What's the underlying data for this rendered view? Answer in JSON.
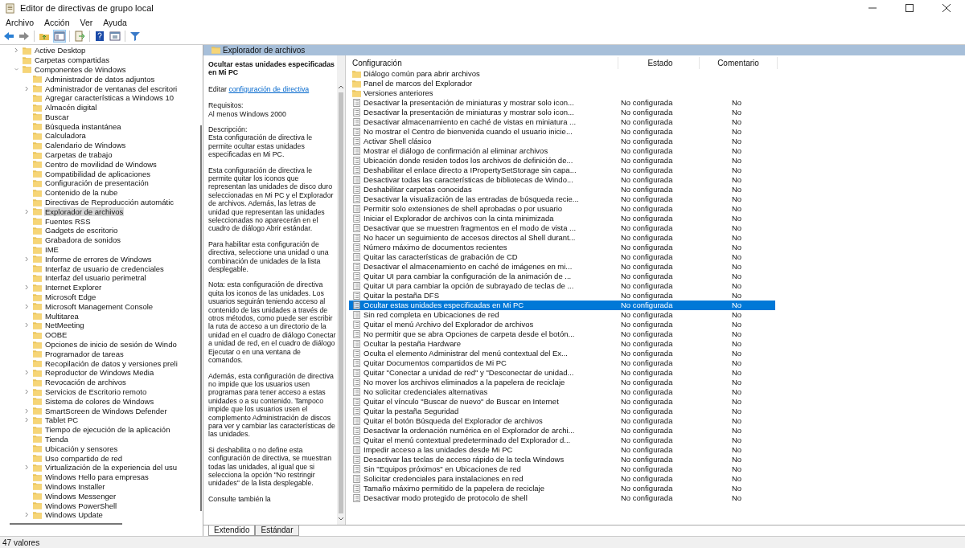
{
  "window": {
    "title": "Editor de directivas de grupo local"
  },
  "menu": [
    "Archivo",
    "Acción",
    "Ver",
    "Ayuda"
  ],
  "tree": [
    {
      "label": "Active Desktop",
      "expanded": false,
      "selected": false
    },
    {
      "label": "Carpetas compartidas",
      "selected": false
    },
    {
      "label": "Componentes de Windows",
      "expanded": true,
      "selected": false,
      "children": [
        {
          "label": "Administrador de datos adjuntos",
          "selected": false
        },
        {
          "label": "Administrador de ventanas del escritori",
          "expanded": false,
          "selected": false
        },
        {
          "label": "Agregar características a Windows 10",
          "selected": false
        },
        {
          "label": "Almacén digital",
          "selected": false
        },
        {
          "label": "Buscar",
          "selected": false
        },
        {
          "label": "Búsqueda instantánea",
          "selected": false
        },
        {
          "label": "Calculadora",
          "selected": false
        },
        {
          "label": "Calendario de Windows",
          "selected": false
        },
        {
          "label": "Carpetas de trabajo",
          "selected": false
        },
        {
          "label": "Centro de movilidad de Windows",
          "selected": false
        },
        {
          "label": "Compatibilidad de aplicaciones",
          "selected": false
        },
        {
          "label": "Configuración de presentación",
          "selected": false
        },
        {
          "label": "Contenido de la nube",
          "selected": false
        },
        {
          "label": "Directivas de Reproducción automátic",
          "selected": false
        },
        {
          "label": "Explorador de archivos",
          "expanded": false,
          "selected": true
        },
        {
          "label": "Fuentes RSS",
          "selected": false
        },
        {
          "label": "Gadgets de escritorio",
          "selected": false
        },
        {
          "label": "Grabadora de sonidos",
          "selected": false
        },
        {
          "label": "IME",
          "selected": false
        },
        {
          "label": "Informe de errores de Windows",
          "expanded": false,
          "selected": false
        },
        {
          "label": "Interfaz de usuario de credenciales",
          "selected": false
        },
        {
          "label": "Interfaz del usuario perimetral",
          "selected": false
        },
        {
          "label": "Internet Explorer",
          "expanded": false,
          "selected": false
        },
        {
          "label": "Microsoft Edge",
          "selected": false
        },
        {
          "label": "Microsoft Management Console",
          "expanded": false,
          "selected": false
        },
        {
          "label": "Multitarea",
          "selected": false
        },
        {
          "label": "NetMeeting",
          "expanded": false,
          "selected": false
        },
        {
          "label": "OOBE",
          "selected": false
        },
        {
          "label": "Opciones de inicio de sesión de Windo",
          "selected": false
        },
        {
          "label": "Programador de tareas",
          "selected": false
        },
        {
          "label": "Recopilación de datos y versiones preli",
          "selected": false
        },
        {
          "label": "Reproductor de Windows Media",
          "expanded": false,
          "selected": false
        },
        {
          "label": "Revocación de archivos",
          "selected": false
        },
        {
          "label": "Servicios de Escritorio remoto",
          "expanded": false,
          "selected": false
        },
        {
          "label": "Sistema de colores de Windows",
          "selected": false
        },
        {
          "label": "SmartScreen de Windows Defender",
          "expanded": false,
          "selected": false
        },
        {
          "label": "Tablet PC",
          "expanded": false,
          "selected": false
        },
        {
          "label": "Tiempo de ejecución de la aplicación",
          "selected": false
        },
        {
          "label": "Tienda",
          "selected": false
        },
        {
          "label": "Ubicación y sensores",
          "selected": false
        },
        {
          "label": "Uso compartido de red",
          "selected": false
        },
        {
          "label": "Virtualización de la experiencia del usu",
          "expanded": false,
          "selected": false
        },
        {
          "label": "Windows Hello para empresas",
          "selected": false
        },
        {
          "label": "Windows Installer",
          "selected": false
        },
        {
          "label": "Windows Messenger",
          "selected": false
        },
        {
          "label": "Windows PowerShell",
          "selected": false
        },
        {
          "label": "Windows Update",
          "expanded": false,
          "selected": false
        }
      ]
    }
  ],
  "folder_header": "Explorador de archivos",
  "description": {
    "title": "Ocultar estas unidades especificadas en Mi PC",
    "edit_text": "Editar",
    "edit_link": "configuración de directiva",
    "blocks": [
      [
        "Requisitos:",
        "Al menos Windows 2000"
      ],
      [
        "Descripción:",
        "Esta configuración de directiva le permite ocultar estas unidades especificadas en Mi PC."
      ],
      [
        "Esta configuración de directiva le permite quitar los iconos que representan las unidades de disco duro seleccionadas en Mi PC y el Explorador de archivos. Además, las letras de unidad que representan las unidades seleccionadas no aparecerán en el cuadro de diálogo Abrir estándar."
      ],
      [
        "Para habilitar esta configuración de directiva, seleccione una unidad o una combinación de unidades de la lista desplegable."
      ],
      [
        "Nota: esta configuración de directiva quita los iconos de las unidades. Los usuarios seguirán teniendo acceso al contenido de las unidades a través de otros métodos, como puede ser escribir la ruta de acceso a un directorio de la unidad en el cuadro de diálogo Conectar a unidad de red, en el cuadro de diálogo Ejecutar o en una ventana de comandos."
      ],
      [
        "Además, esta configuración de directiva no impide que los usuarios usen programas para tener acceso a estas unidades o a su contenido. Tampoco impide que los usuarios usen el complemento Administración de discos para ver y cambiar las características de las unidades."
      ],
      [
        "Si deshabilita o no define esta configuración de directiva, se muestran todas las unidades, al igual que si selecciona la opción \"No restringir unidades\" de la lista desplegable."
      ],
      [
        "Consulte también la"
      ]
    ]
  },
  "columns": [
    "Configuración",
    "Estado",
    "Comentario"
  ],
  "rows": [
    {
      "kind": "folder",
      "label": "Diálogo común para abrir archivos",
      "selected": false
    },
    {
      "kind": "folder",
      "label": "Panel de marcos del Explorador",
      "selected": false
    },
    {
      "kind": "folder",
      "label": "Versiones anteriores",
      "selected": false
    },
    {
      "kind": "setting",
      "label": "Desactivar la presentación de miniaturas y mostrar solo icon...",
      "state": "No configurada",
      "comment": "No",
      "selected": false
    },
    {
      "kind": "setting",
      "label": "Desactivar la presentación de miniaturas y mostrar solo icon...",
      "state": "No configurada",
      "comment": "No",
      "selected": false
    },
    {
      "kind": "setting",
      "label": "Desactivar almacenamiento en caché de vistas en miniatura ...",
      "state": "No configurada",
      "comment": "No",
      "selected": false
    },
    {
      "kind": "setting",
      "label": "No mostrar el Centro de bienvenida cuando el usuario inicie...",
      "state": "No configurada",
      "comment": "No",
      "selected": false
    },
    {
      "kind": "setting",
      "label": "Activar Shell clásico",
      "state": "No configurada",
      "comment": "No",
      "selected": false
    },
    {
      "kind": "setting",
      "label": "Mostrar el diálogo de confirmación al eliminar archivos",
      "state": "No configurada",
      "comment": "No",
      "selected": false
    },
    {
      "kind": "setting",
      "label": "Ubicación donde residen todos los archivos de definición de...",
      "state": "No configurada",
      "comment": "No",
      "selected": false
    },
    {
      "kind": "setting",
      "label": "Deshabilitar el enlace directo a IPropertySetStorage sin capa...",
      "state": "No configurada",
      "comment": "No",
      "selected": false
    },
    {
      "kind": "setting",
      "label": "Desactivar todas las características de bibliotecas de Windo...",
      "state": "No configurada",
      "comment": "No",
      "selected": false
    },
    {
      "kind": "setting",
      "label": "Deshabilitar carpetas conocidas",
      "state": "No configurada",
      "comment": "No",
      "selected": false
    },
    {
      "kind": "setting",
      "label": "Desactivar la visualización de las entradas de búsqueda recie...",
      "state": "No configurada",
      "comment": "No",
      "selected": false
    },
    {
      "kind": "setting",
      "label": "Permitir solo extensiones de shell aprobadas o por usuario",
      "state": "No configurada",
      "comment": "No",
      "selected": false
    },
    {
      "kind": "setting",
      "label": "Iniciar el Explorador de archivos con la cinta minimizada",
      "state": "No configurada",
      "comment": "No",
      "selected": false
    },
    {
      "kind": "setting",
      "label": "Desactivar que se muestren fragmentos en el modo de vista ...",
      "state": "No configurada",
      "comment": "No",
      "selected": false
    },
    {
      "kind": "setting",
      "label": "No hacer un seguimiento de accesos directos al Shell durant...",
      "state": "No configurada",
      "comment": "No",
      "selected": false
    },
    {
      "kind": "setting",
      "label": "Número máximo de documentos recientes",
      "state": "No configurada",
      "comment": "No",
      "selected": false
    },
    {
      "kind": "setting",
      "label": "Quitar las características de grabación de CD",
      "state": "No configurada",
      "comment": "No",
      "selected": false
    },
    {
      "kind": "setting",
      "label": "Desactivar el almacenamiento en caché de imágenes en mi...",
      "state": "No configurada",
      "comment": "No",
      "selected": false
    },
    {
      "kind": "setting",
      "label": "Quitar UI para cambiar la configuración de la animación de ...",
      "state": "No configurada",
      "comment": "No",
      "selected": false
    },
    {
      "kind": "setting",
      "label": "Quitar UI para cambiar la opción de subrayado de teclas de ...",
      "state": "No configurada",
      "comment": "No",
      "selected": false
    },
    {
      "kind": "setting",
      "label": "Quitar la pestaña DFS",
      "state": "No configurada",
      "comment": "No",
      "selected": false
    },
    {
      "kind": "setting",
      "label": "Ocultar estas unidades especificadas en Mi PC",
      "state": "No configurada",
      "comment": "No",
      "selected": true
    },
    {
      "kind": "setting",
      "label": "Sin red completa en Ubicaciones de red",
      "state": "No configurada",
      "comment": "No",
      "selected": false
    },
    {
      "kind": "setting",
      "label": "Quitar el menú Archivo del Explorador de archivos",
      "state": "No configurada",
      "comment": "No",
      "selected": false
    },
    {
      "kind": "setting",
      "label": "No permitir que se abra Opciones de carpeta desde el botón...",
      "state": "No configurada",
      "comment": "No",
      "selected": false
    },
    {
      "kind": "setting",
      "label": "Ocultar la pestaña Hardware",
      "state": "No configurada",
      "comment": "No",
      "selected": false
    },
    {
      "kind": "setting",
      "label": "Oculta el elemento Administrar del menú contextual del Ex...",
      "state": "No configurada",
      "comment": "No",
      "selected": false
    },
    {
      "kind": "setting",
      "label": "Quitar Documentos compartidos de Mi PC",
      "state": "No configurada",
      "comment": "No",
      "selected": false
    },
    {
      "kind": "setting",
      "label": "Quitar \"Conectar a unidad de red\" y \"Desconectar de unidad...",
      "state": "No configurada",
      "comment": "No",
      "selected": false
    },
    {
      "kind": "setting",
      "label": "No mover los archivos eliminados a la papelera de reciclaje",
      "state": "No configurada",
      "comment": "No",
      "selected": false
    },
    {
      "kind": "setting",
      "label": "No solicitar credenciales alternativas",
      "state": "No configurada",
      "comment": "No",
      "selected": false
    },
    {
      "kind": "setting",
      "label": "Quitar el vínculo \"Buscar de nuevo\" de Buscar en Internet",
      "state": "No configurada",
      "comment": "No",
      "selected": false
    },
    {
      "kind": "setting",
      "label": "Quitar la pestaña Seguridad",
      "state": "No configurada",
      "comment": "No",
      "selected": false
    },
    {
      "kind": "setting",
      "label": "Quitar el botón Búsqueda del Explorador de archivos",
      "state": "No configurada",
      "comment": "No",
      "selected": false
    },
    {
      "kind": "setting",
      "label": "Desactivar la ordenación numérica en el Explorador de archi...",
      "state": "No configurada",
      "comment": "No",
      "selected": false
    },
    {
      "kind": "setting",
      "label": "Quitar el menú contextual predeterminado del Explorador d...",
      "state": "No configurada",
      "comment": "No",
      "selected": false
    },
    {
      "kind": "setting",
      "label": "Impedir acceso a las unidades desde Mi PC",
      "state": "No configurada",
      "comment": "No",
      "selected": false
    },
    {
      "kind": "setting",
      "label": "Desactivar las teclas de acceso rápido de la tecla Windows",
      "state": "No configurada",
      "comment": "No",
      "selected": false
    },
    {
      "kind": "setting",
      "label": "Sin \"Equipos próximos\" en Ubicaciones de red",
      "state": "No configurada",
      "comment": "No",
      "selected": false
    },
    {
      "kind": "setting",
      "label": "Solicitar credenciales para instalaciones en red",
      "state": "No configurada",
      "comment": "No",
      "selected": false
    },
    {
      "kind": "setting",
      "label": "Tamaño máximo permitido de la papelera de reciclaje",
      "state": "No configurada",
      "comment": "No",
      "selected": false
    },
    {
      "kind": "setting",
      "label": "Desactivar modo protegido de protocolo de shell",
      "state": "No configurada",
      "comment": "No",
      "selected": false
    }
  ],
  "view_tabs": [
    {
      "label": "Extendido",
      "selected": true
    },
    {
      "label": "Estándar",
      "selected": false
    }
  ],
  "status_bar": "47 valores"
}
